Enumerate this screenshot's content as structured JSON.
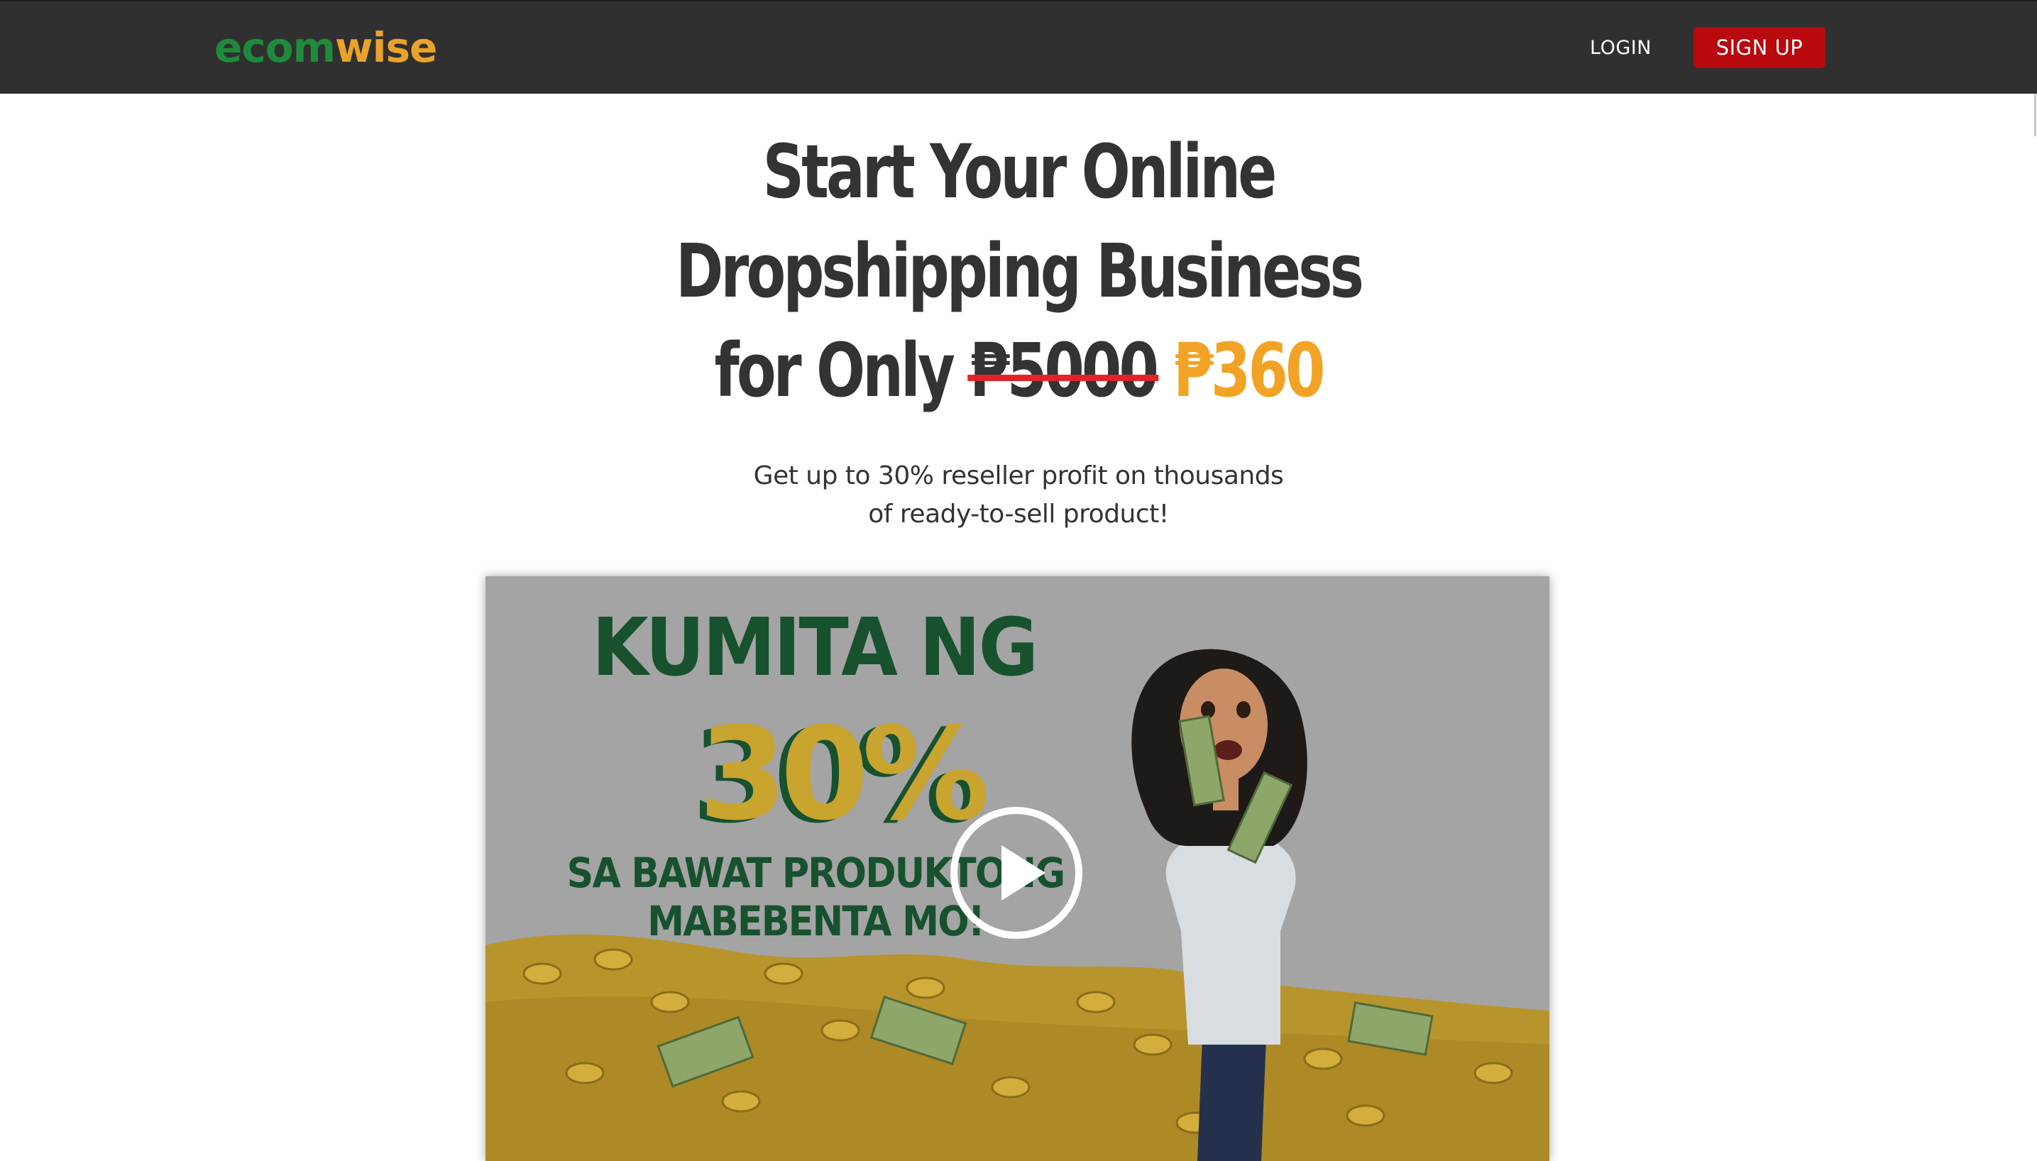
{
  "nav": {
    "logo_part1": "ecom",
    "logo_part2": "wise",
    "login_label": "LOGIN",
    "signup_label": "SIGN UP"
  },
  "hero": {
    "headline_line1": "Start Your Online",
    "headline_line2": "Dropshipping Business",
    "headline_line3_prefix": "for Only",
    "old_price": "₱5000",
    "new_price": "₱360",
    "subtitle_line1": "Get up to 30% reseller profit on thousands",
    "subtitle_line2": "of ready-to-sell product!"
  },
  "video": {
    "title": "KUMITA NG",
    "percent": "30%",
    "sub_line1": "SA BAWAT PRODUKTONG",
    "sub_line2": "MABEBENTA MO!",
    "play_icon": "play-circle-icon"
  },
  "colors": {
    "navbar_bg": "#303030",
    "brand_green": "#1f8a3c",
    "brand_orange": "#e9a32a",
    "signup_red": "#b8090e",
    "strike_red": "#e0252a",
    "price_orange": "#f2a325",
    "video_green": "#17512e",
    "video_gold": "#c9a42e"
  }
}
